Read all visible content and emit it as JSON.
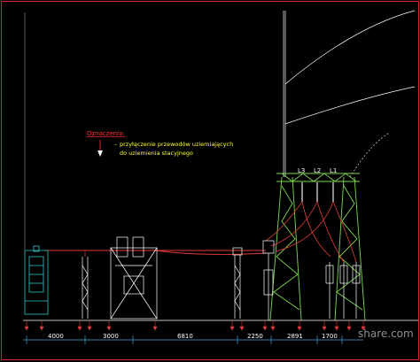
{
  "legend": {
    "title": "Oznaczenia:",
    "dash": "–",
    "line1": "przyłączenie przewodów uziemiających",
    "line2": "do uziemienia stacyjnego"
  },
  "phases": [
    "L3",
    "L2",
    "L1"
  ],
  "dimensions": [
    "4000",
    "3000",
    "6810",
    "2250",
    "2891",
    "1700"
  ],
  "watermark": "share.com",
  "colors": {
    "background": "#000000",
    "frame": "#d42a2a",
    "structure": "#ffffff",
    "equipment_cyan": "#2ec9c9",
    "tower_green": "#7fd64f",
    "conductor_red": "#e23a3a",
    "dimension_cyan": "#40a8d8",
    "text_yellow": "#ffff33"
  }
}
